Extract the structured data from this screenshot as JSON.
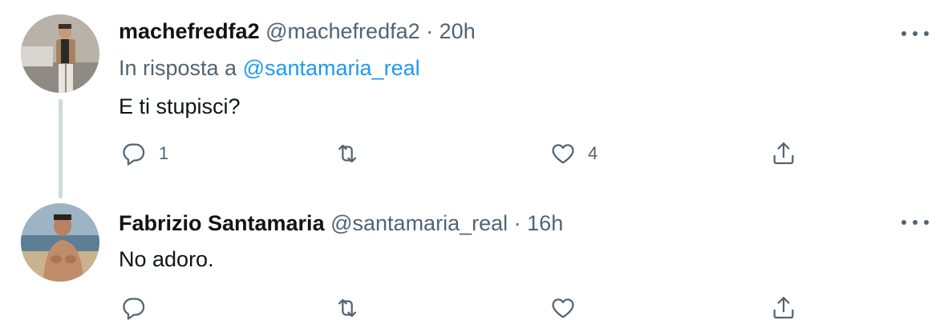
{
  "tweets": [
    {
      "author_name": "machefredfa2",
      "handle": "@machefredfa2",
      "separator": "·",
      "time": "20h",
      "reply_prefix": "In risposta a",
      "reply_mention": "@santamaria_real",
      "text": "E ti stupisci?",
      "reply_count": "1",
      "retweet_count": "",
      "like_count": "4"
    },
    {
      "author_name": "Fabrizio Santamaria",
      "handle": "@santamaria_real",
      "separator": "·",
      "time": "16h",
      "text": "No adoro.",
      "reply_count": "",
      "retweet_count": "",
      "like_count": ""
    }
  ],
  "icons": {
    "reply": "reply-icon",
    "retweet": "retweet-icon",
    "like": "heart-icon",
    "share": "share-icon",
    "more": "more-options-icon"
  },
  "colors": {
    "text_primary": "#0f1419",
    "text_secondary": "#536471",
    "link": "#1d9bf0",
    "thread_line": "#cfd9de"
  }
}
